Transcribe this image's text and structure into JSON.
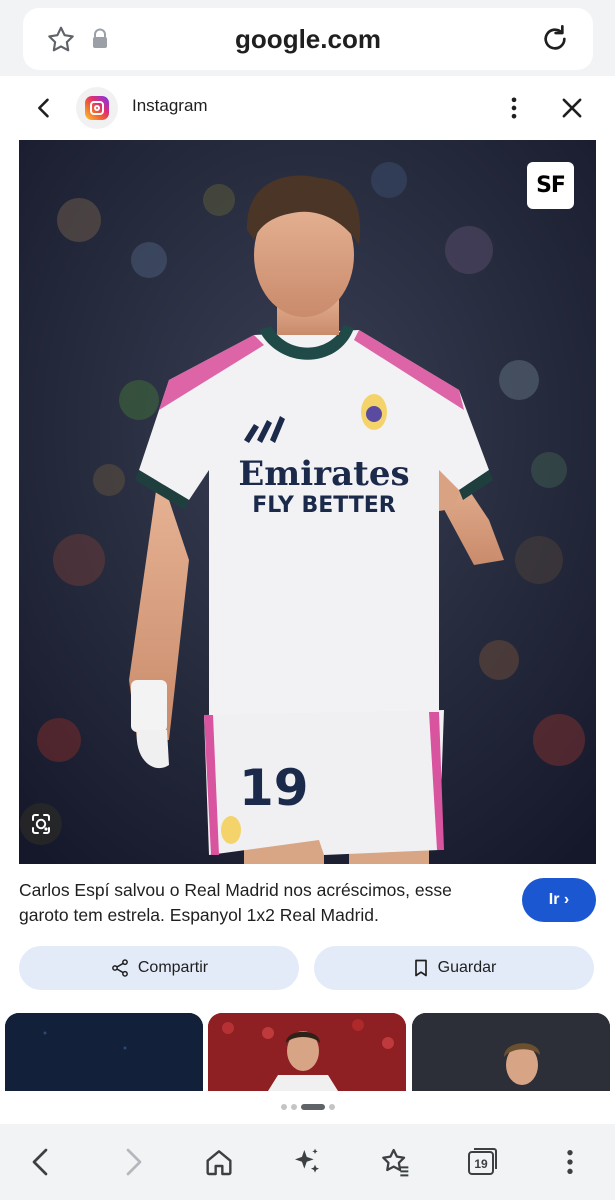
{
  "address_bar": {
    "url": "google.com",
    "icons": [
      "star-outline-icon",
      "lock-icon",
      "reload-icon"
    ]
  },
  "header": {
    "source_name": "Instagram",
    "icons": [
      "back-arrow-icon",
      "instagram-logo-icon",
      "more-vert-icon",
      "close-icon"
    ]
  },
  "image": {
    "watermark": "SF",
    "jersey_sponsor_line1": "Emirates",
    "jersey_sponsor_line2": "FLY BETTER",
    "shorts_number": "19",
    "lens_icon": "google-lens-icon"
  },
  "result": {
    "caption": "Carlos Espí salvou o Real Madrid nos acréscimos, esse garoto tem estrela. Espanyol 1x2 Real Madrid.",
    "go_label": "Ir"
  },
  "actions": {
    "share_label": "Compartir",
    "save_label": "Guardar"
  },
  "carousel": {
    "thumbnail_count": 3,
    "dot_count": 4,
    "active_dot": 2
  },
  "bottom_nav": {
    "tab_count": "19",
    "icons": [
      "back-icon",
      "forward-icon",
      "home-icon",
      "sparkle-icon",
      "bookmarks-icon",
      "tabs-icon",
      "more-vert-icon"
    ]
  },
  "colors": {
    "accent": "#1a57d1",
    "pill_bg": "#e3ebf8",
    "toolbar_bg": "#f1f3f4"
  }
}
